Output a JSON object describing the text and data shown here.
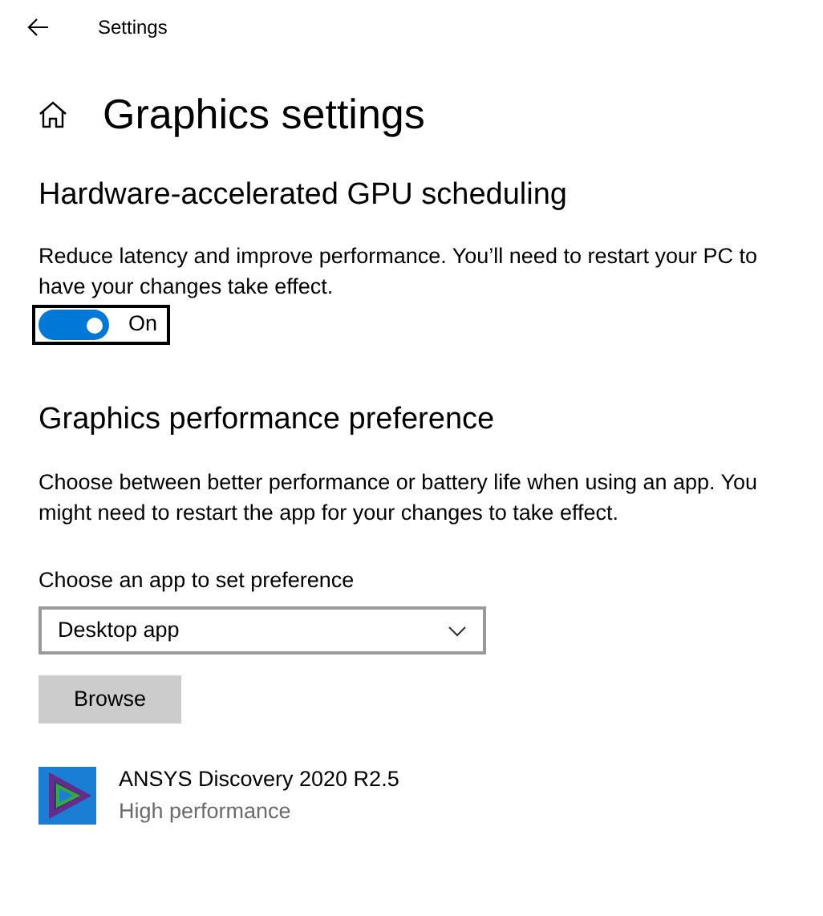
{
  "window": {
    "title": "Settings"
  },
  "page": {
    "title": "Graphics settings"
  },
  "gpu_scheduling": {
    "heading": "Hardware-accelerated GPU scheduling",
    "description": "Reduce latency and improve performance. You’ll need to restart your PC to have your changes take effect.",
    "toggle": {
      "on": true,
      "label": "On"
    }
  },
  "performance_preference": {
    "heading": "Graphics performance preference",
    "description": "Choose between better performance or battery life when using an app. You might need to restart the app for your changes to take effect.",
    "app_type_label": "Choose an app to set preference",
    "app_type": {
      "value": "Desktop app"
    },
    "browse_button": "Browse",
    "apps": [
      {
        "name": "ANSYS Discovery 2020 R2.5",
        "preference": "High performance"
      }
    ]
  }
}
